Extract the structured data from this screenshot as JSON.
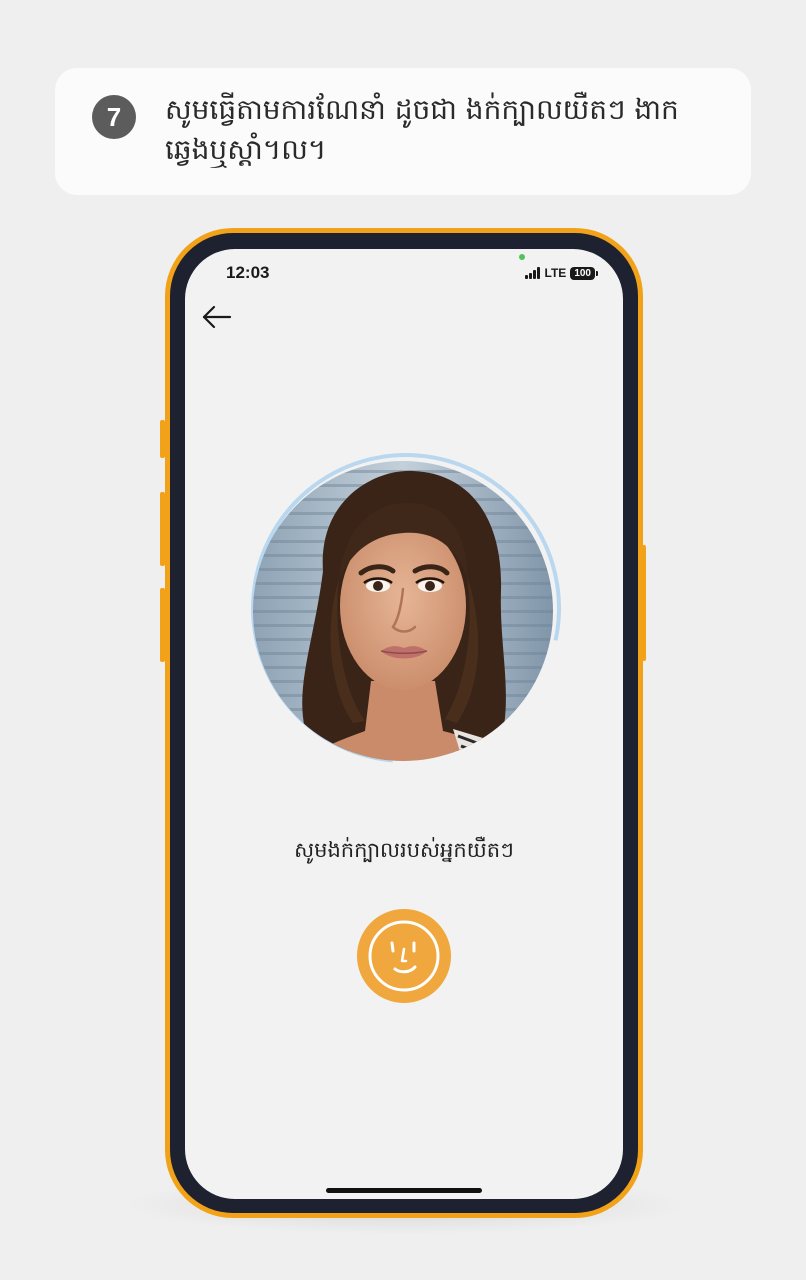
{
  "instruction": {
    "step_number": "7",
    "text": "សូមធ្វើតាមការណែនាំ ដូចជា ងក់ក្បាលយឺតៗ ងាកឆ្វេងឬស្តាំ។ល។"
  },
  "phone": {
    "status_bar": {
      "time": "12:03",
      "network": "LTE",
      "battery": "100"
    },
    "screen": {
      "back_icon": "arrow-left-icon",
      "face_prompt": "សូមងក់ក្បាលរបស់អ្នកយឺតៗ",
      "face_button_icon": "smiley-face-icon"
    }
  },
  "colors": {
    "accent": "#f0a73d",
    "phone_frame": "#f2a218",
    "ring": "#b9d7ef",
    "step_badge": "#5c5c5c"
  }
}
